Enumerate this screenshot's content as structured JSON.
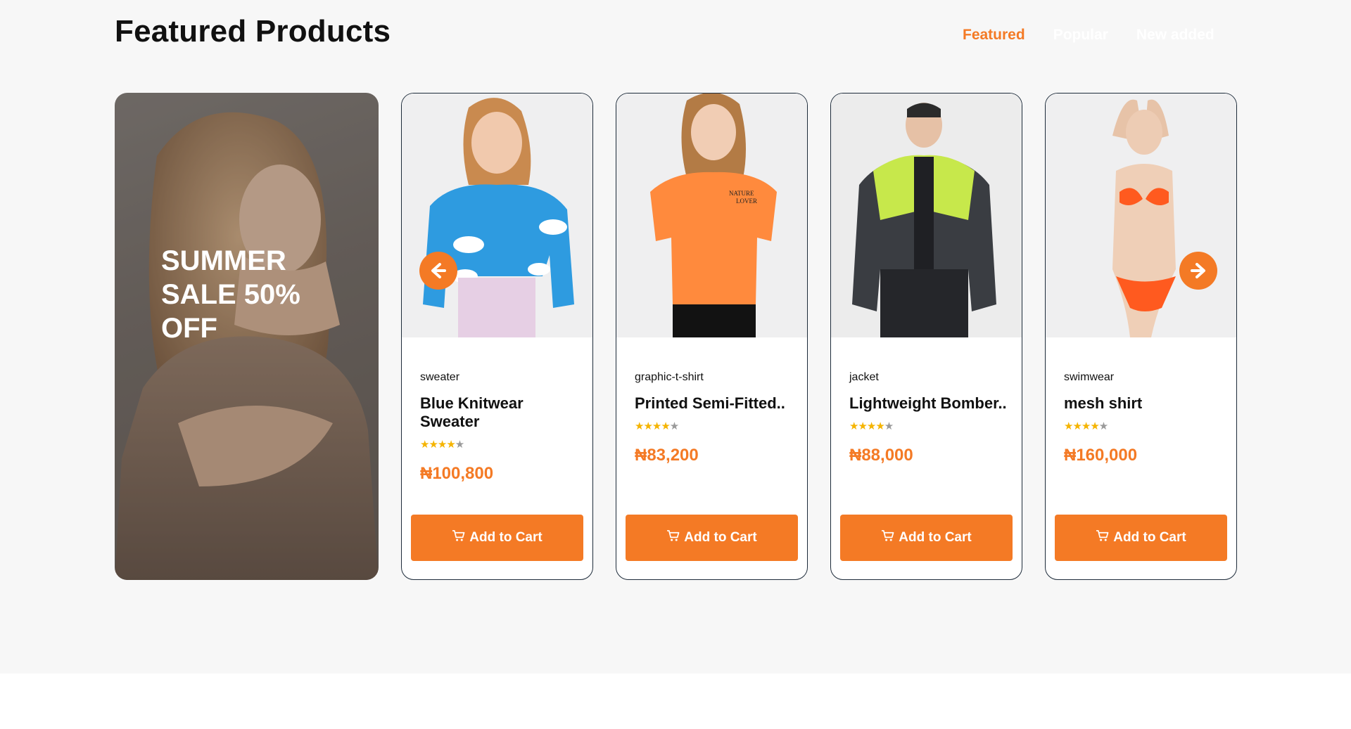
{
  "header": {
    "title": "Featured Products",
    "tabs": [
      {
        "label": "Featured",
        "active": true
      },
      {
        "label": "Popular",
        "active": false
      },
      {
        "label": "New added",
        "active": false
      }
    ]
  },
  "promo": {
    "text": "SUMMER SALE 50% OFF"
  },
  "products": [
    {
      "category": "sweater",
      "name": "Blue Knitwear Sweater",
      "rating": 4,
      "price": "₦100,800",
      "button": "Add to Cart",
      "image": "woman-blue-cloud-sweater"
    },
    {
      "category": "graphic-t-shirt",
      "name": "Printed Semi-Fitted..",
      "rating": 4,
      "price": "₦83,200",
      "button": "Add to Cart",
      "image": "woman-orange-tshirt"
    },
    {
      "category": "jacket",
      "name": "Lightweight Bomber..",
      "rating": 4,
      "price": "₦88,000",
      "button": "Add to Cart",
      "image": "man-lime-black-jacket"
    },
    {
      "category": "swimwear",
      "name": "mesh shirt",
      "rating": 4,
      "price": "₦160,000",
      "button": "Add to Cart",
      "image": "woman-orange-bikini"
    }
  ],
  "icons": {
    "prev": "arrow-left-icon",
    "next": "arrow-right-icon",
    "cart": "cart-icon"
  },
  "colors": {
    "accent": "#f47a25",
    "star": "#f5b400",
    "border": "#1d2b3a"
  }
}
